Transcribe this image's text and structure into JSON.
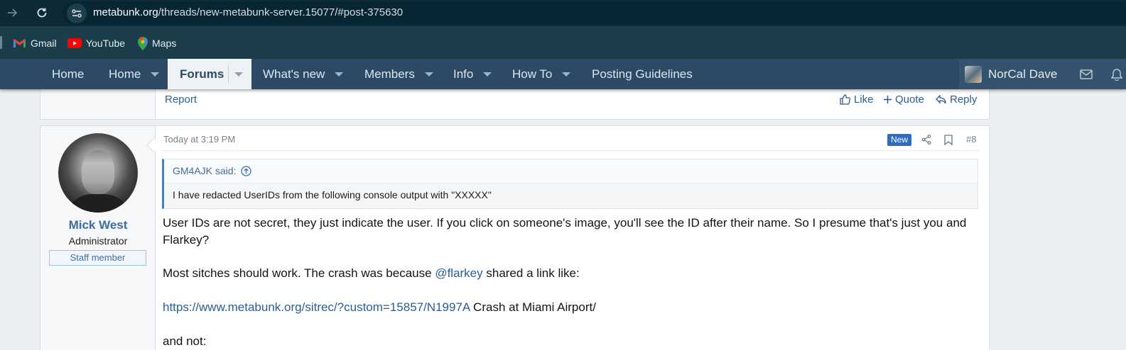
{
  "browser": {
    "url_host": "metabunk.org",
    "url_path": "/threads/new-metabunk-server.15077/#post-375630",
    "bookmarks": [
      {
        "label": "Gmail",
        "icon": "gmail-icon"
      },
      {
        "label": "YouTube",
        "icon": "youtube-icon"
      },
      {
        "label": "Maps",
        "icon": "maps-icon"
      }
    ]
  },
  "navbar": {
    "home_logo_label": "Home",
    "items": [
      {
        "label": "Home"
      },
      {
        "label": "Forums"
      },
      {
        "label": "What's new"
      },
      {
        "label": "Members"
      },
      {
        "label": "Info"
      },
      {
        "label": "How To"
      },
      {
        "label": "Posting Guidelines"
      }
    ],
    "user_name": "NorCal Dave"
  },
  "previous_post": {
    "report_label": "Report",
    "actions": {
      "like": "Like",
      "quote": "Quote",
      "reply": "Reply"
    }
  },
  "post": {
    "time": "Today at 3:19 PM",
    "badge": "New",
    "number": "#8",
    "author": {
      "name": "Mick West",
      "title": "Administrator",
      "banner": "Staff member"
    },
    "quote": {
      "author": "GM4AJK said:",
      "text": "I have redacted UserIDs from the following console output with \"XXXXX\""
    },
    "para1": "User IDs are not secret, they just indicate the user. If you click on someone's image, you'll see the ID after their name. So I presume that's just you and",
    "para1_cont": "Flarkey?",
    "para2_before": "Most sitches should work. The crash was because ",
    "para2_mention": "@flarkey",
    "para2_after": " shared a link like:",
    "para3_link": "https://www.metabunk.org/sitrec/?custom=15857/N1997A",
    "para3_after": " Crash at Miami Airport/",
    "para4": "and not:"
  },
  "colors": {
    "chrome": "#0e2a36",
    "bookmarks_bar": "#1c3e4b",
    "navbar": "#2c4a66",
    "link": "#2d5d8f",
    "new_badge": "#2f6cc0"
  }
}
